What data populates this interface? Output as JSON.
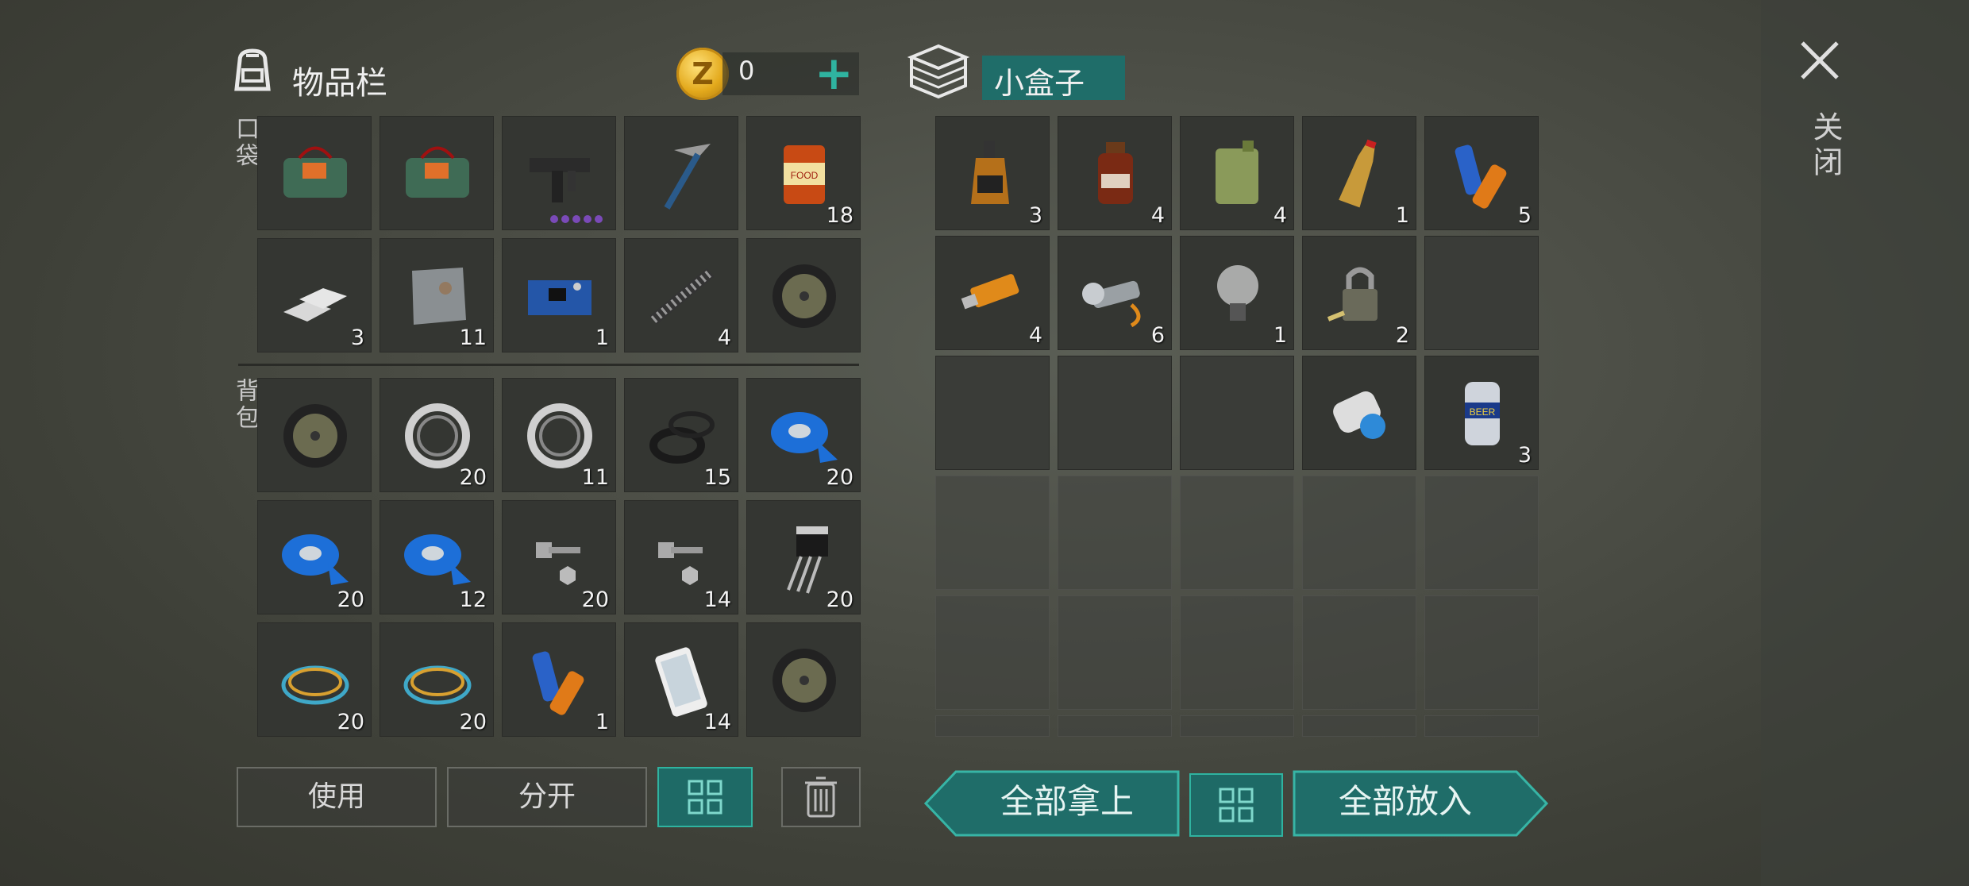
{
  "inventory": {
    "title": "物品栏",
    "coins": "0",
    "coin_symbol": "Z",
    "add_label": "+",
    "pocket_label": "口袋",
    "backpack_label": "背包",
    "pocket_items": [
      {
        "name": "explosive-pack",
        "qty": ""
      },
      {
        "name": "explosive-pack",
        "qty": ""
      },
      {
        "name": "uzi-smg",
        "qty": ""
      },
      {
        "name": "pickaxe",
        "qty": ""
      },
      {
        "name": "canned-food",
        "qty": "18"
      },
      {
        "name": "aluminum-bars",
        "qty": "3"
      },
      {
        "name": "metal-plate",
        "qty": "11"
      },
      {
        "name": "circuit-board",
        "qty": "1"
      },
      {
        "name": "spring",
        "qty": "4"
      },
      {
        "name": "wheel",
        "qty": ""
      }
    ],
    "backpack_items": [
      {
        "name": "wheel",
        "qty": ""
      },
      {
        "name": "bearing",
        "qty": "20"
      },
      {
        "name": "bearing",
        "qty": "11"
      },
      {
        "name": "rubber-seals",
        "qty": "15"
      },
      {
        "name": "blue-tape",
        "qty": "20"
      },
      {
        "name": "blue-tape",
        "qty": "20"
      },
      {
        "name": "blue-tape",
        "qty": "12"
      },
      {
        "name": "bolt-nut",
        "qty": "20"
      },
      {
        "name": "bolt-nut",
        "qty": "14"
      },
      {
        "name": "transistor",
        "qty": "20"
      },
      {
        "name": "wires",
        "qty": "20"
      },
      {
        "name": "wires",
        "qty": "20"
      },
      {
        "name": "batteries",
        "qty": "1"
      },
      {
        "name": "smartphone",
        "qty": "14"
      },
      {
        "name": "wheel",
        "qty": ""
      }
    ],
    "buttons": {
      "use": "使用",
      "split": "分开"
    }
  },
  "box": {
    "title": "小盒子",
    "items": [
      {
        "name": "whiskey",
        "qty": "3"
      },
      {
        "name": "medicine-bottle",
        "qty": "4"
      },
      {
        "name": "jerrycan",
        "qty": "4"
      },
      {
        "name": "soda-bottle",
        "qty": "1"
      },
      {
        "name": "batteries",
        "qty": "5"
      },
      {
        "name": "usb-drive",
        "qty": "4"
      },
      {
        "name": "flashlight",
        "qty": "6"
      },
      {
        "name": "light-bulb",
        "qty": "1"
      },
      {
        "name": "padlock",
        "qty": "2"
      },
      {
        "name": "empty",
        "qty": ""
      },
      {
        "name": "empty",
        "qty": ""
      },
      {
        "name": "empty",
        "qty": ""
      },
      {
        "name": "empty",
        "qty": ""
      },
      {
        "name": "blueprint-scroll",
        "qty": ""
      },
      {
        "name": "beer-can",
        "qty": "3"
      }
    ],
    "buttons": {
      "take_all": "全部拿上",
      "put_all": "全部放入"
    }
  },
  "close_label": "关闭",
  "colors": {
    "accent": "#2fb3a0",
    "teal_bg": "#1f6d69"
  }
}
